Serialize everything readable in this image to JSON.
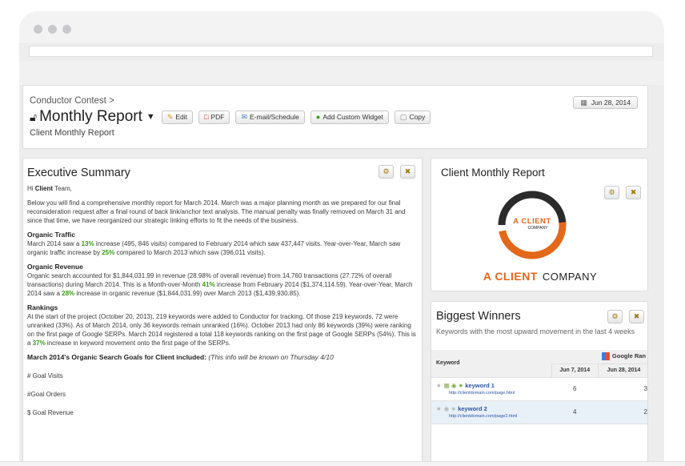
{
  "header": {
    "breadcrumb": "Conductor Contest >",
    "title": "Monthly Report",
    "subtitle": "Client Monthly Report",
    "date": "Jun 28, 2014",
    "buttons": {
      "edit": "Edit",
      "pdf": "PDF",
      "email": "E-mail/Schedule",
      "add_widget": "Add Custom Widget",
      "copy": "Copy"
    }
  },
  "exec": {
    "title": "Executive Summary",
    "greeting_pre": "Hi ",
    "greeting_bold": "Client",
    "greeting_post": " Team,",
    "intro": "Below you will find a comprehensive monthly report for March 2014. March was a major planning month as we prepared for our final reconsideration request after a final round of back link/anchor text analysis. The manual penalty was finally removed on March 31 and since that time, we have reorganized our strategic linking efforts to fit the needs of the business.",
    "traffic_heading": "Organic Traffic",
    "traffic_1": "March 2014 saw a ",
    "traffic_pct1": "13%",
    "traffic_2": " increase (495, 846 visits) compared to February 2014 which saw 437,447 visits. Year-over-Year, March saw organic traffic increase by ",
    "traffic_pct2": "25%",
    "traffic_3": " compared to March 2013 which saw (396,011 visits).",
    "revenue_heading": "Organic Revenue",
    "revenue_1": "Organic search accounted for $1,844,031.99 in revenue (28.98% of overall revenue) from 14,760 transactions (27.72% of overall transactions) during March 2014. This is a Month-over-Month ",
    "revenue_pct1": "41%",
    "revenue_2": " increase from February 2014 ($1,374,114.59). Year-over-Year, March 2014 saw a ",
    "revenue_pct2": "28%",
    "revenue_3": " increase in organic revenue ($1,844,031.99) over March 2013 ($1,439,930.85).",
    "rankings_heading": "Rankings",
    "rankings_1": "At the start of the project (October 20, 2013), 219 keywords were added to Conductor for tracking. Of those 219 keywords, 72 were unranked (33%). As of March 2014, only 36 keywords remain unranked (16%). October 2013 had only 86 keywords (39%) were ranking on the first page of Google SERPs. March 2014 registered a total 118 keywords ranking on the first page of Google SERPs (54%). This is a ",
    "rankings_pct": "37%",
    "rankings_2": " increase in keyword movement onto the first page of the SERPs.",
    "goals_1": "March 2014's Organic Search Goals for ",
    "goals_client": "Client",
    "goals_2": " included: ",
    "goals_note": "(This info will be known on Thursday 4/10",
    "goal_visits": "# Goal Visits",
    "goal_orders": "#Goal Orders",
    "goal_revenue": "$ Goal Revenue"
  },
  "client_widget": {
    "title": "Client  Monthly Report",
    "ring_line1": "A CLIENT",
    "ring_line2": "COMPANY",
    "logo_a": "A CLIENT",
    "logo_b": "COMPANY",
    "accent_color": "#e4681a"
  },
  "winners": {
    "title": "Biggest Winners",
    "subtitle": "Keywords with the most upward movement in the last 4 weeks",
    "col_keyword": "Keyword",
    "col_group": "Google Ran",
    "dates": [
      "Jun 7, 2014",
      "Jun 28, 2014"
    ],
    "rows": [
      {
        "keyword": "keyword 1",
        "url": "http://clientdomain.com/page.html",
        "v1": "6",
        "v2": "3"
      },
      {
        "keyword": "keyword 2",
        "url": "http://clientdomain.com/page2.html",
        "v1": "4",
        "v2": "2"
      }
    ]
  }
}
